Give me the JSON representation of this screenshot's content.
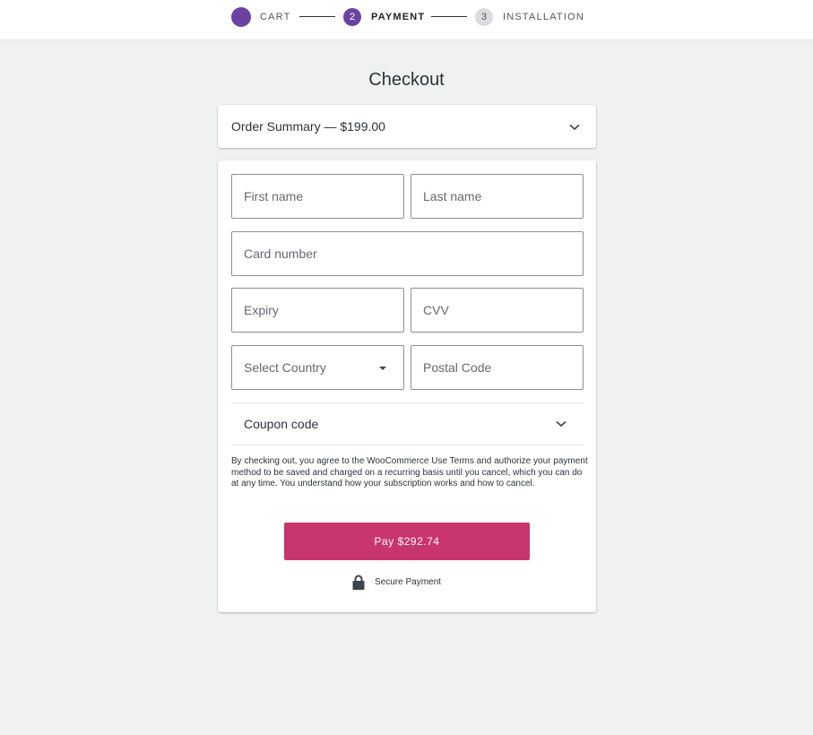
{
  "stepper": {
    "steps": [
      {
        "label": "CART",
        "number": ""
      },
      {
        "label": "PAYMENT",
        "number": "2"
      },
      {
        "label": "INSTALLATION",
        "number": "3"
      }
    ]
  },
  "checkout": {
    "title": "Checkout",
    "summary": "Order Summary — $199.00"
  },
  "form": {
    "first_name": {
      "placeholder": "First name"
    },
    "last_name": {
      "placeholder": "Last name"
    },
    "card_number": {
      "placeholder": "Card number"
    },
    "expiry": {
      "placeholder": "Expiry"
    },
    "cvv": {
      "placeholder": "CVV"
    },
    "country": {
      "selected": "Select Country"
    },
    "postal_code": {
      "placeholder": "Postal Code"
    },
    "coupon_label": "Coupon code",
    "terms": "By checking out, you agree to the WooCommerce Use Terms and authorize your payment method to be saved and charged on a recurring basis until you cancel, which you can do at any time. You understand how your subscription works and how to cancel.",
    "pay_label": "Pay $292.74",
    "secure_label": "Secure Payment"
  },
  "icons": {
    "summary_toggle": "chevron-down-icon",
    "country_caret": "caret-down-icon",
    "coupon_toggle": "chevron-down-icon",
    "secure": "lock-icon"
  },
  "colors": {
    "accent_purple": "#6b42a1",
    "pay_button": "#c9356e",
    "inactive_step": "#dcdcde",
    "background": "#f0f2f1"
  }
}
